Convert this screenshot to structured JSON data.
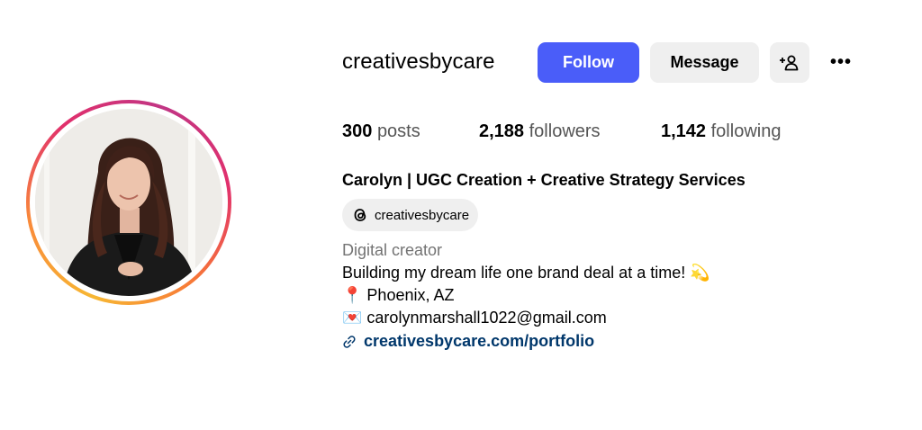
{
  "profile": {
    "username": "creativesbycare",
    "full_name": "Carolyn | UGC Creation + Creative Strategy Services",
    "threads_handle": "creativesbycare",
    "category": "Digital creator",
    "bio": [
      {
        "text": "Building my dream life one brand deal at a time! ",
        "emoji": "💫"
      },
      {
        "emoji": "📍",
        "text": " Phoenix, AZ"
      },
      {
        "emoji": "💌",
        "text": "  carolynmarshall1022@gmail.com"
      }
    ],
    "link": "creativesbycare.com/portfolio"
  },
  "actions": {
    "follow_label": "Follow",
    "message_label": "Message",
    "add_user_icon": "add-user-icon",
    "more_icon": "more-icon",
    "more_glyph": "•••"
  },
  "stats": {
    "posts_count": "300",
    "posts_label": "posts",
    "followers_count": "2,188",
    "followers_label": "followers",
    "following_count": "1,142",
    "following_label": "following"
  },
  "colors": {
    "follow_button": "#4a5df9",
    "secondary_button": "#efefef",
    "link": "#00376b",
    "muted_text": "#737373"
  }
}
